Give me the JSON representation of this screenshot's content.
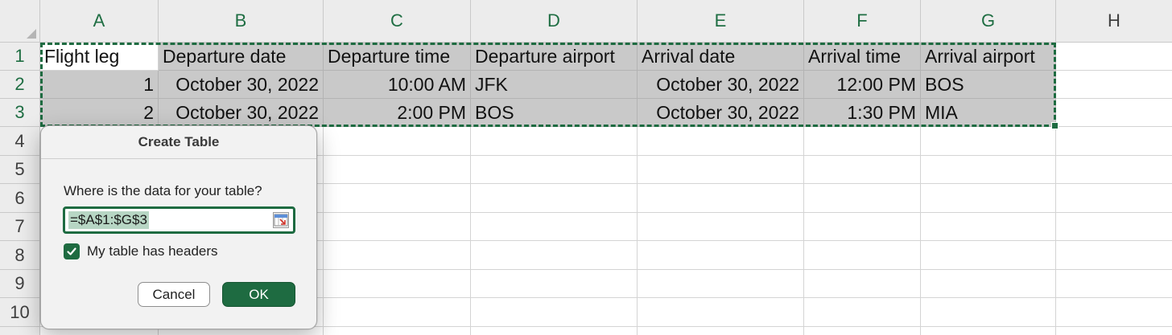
{
  "columns": [
    "A",
    "B",
    "C",
    "D",
    "E",
    "F",
    "G",
    "H"
  ],
  "rows": [
    "1",
    "2",
    "3",
    "4",
    "5",
    "6",
    "7",
    "8",
    "9",
    "10"
  ],
  "headers": {
    "A1": "Flight leg",
    "B1": "Departure date",
    "C1": "Departure time",
    "D1": "Departure airport",
    "E1": "Arrival date",
    "F1": "Arrival time",
    "G1": "Arrival airport"
  },
  "data_rows": [
    {
      "flight_leg": "1",
      "departure_date": "October 30, 2022",
      "departure_time": "10:00 AM",
      "departure_airport": "JFK",
      "arrival_date": "October 30, 2022",
      "arrival_time": "12:00 PM",
      "arrival_airport": "BOS"
    },
    {
      "flight_leg": "2",
      "departure_date": "October 30, 2022",
      "departure_time": "2:00 PM",
      "departure_airport": "BOS",
      "arrival_date": "October 30, 2022",
      "arrival_time": "1:30 PM",
      "arrival_airport": "MIA"
    }
  ],
  "dialog": {
    "title": "Create Table",
    "prompt": "Where is the data for your table?",
    "range_value": "=$A$1:$G$3",
    "has_headers_label": "My table has headers",
    "has_headers_checked": true,
    "cancel_label": "Cancel",
    "ok_label": "OK"
  },
  "colors": {
    "accent": "#1e6b41",
    "selection_fill": "#c9c9c9",
    "header_bg": "#ececec"
  },
  "icons": [
    "range-picker-icon",
    "checkmark-icon"
  ]
}
